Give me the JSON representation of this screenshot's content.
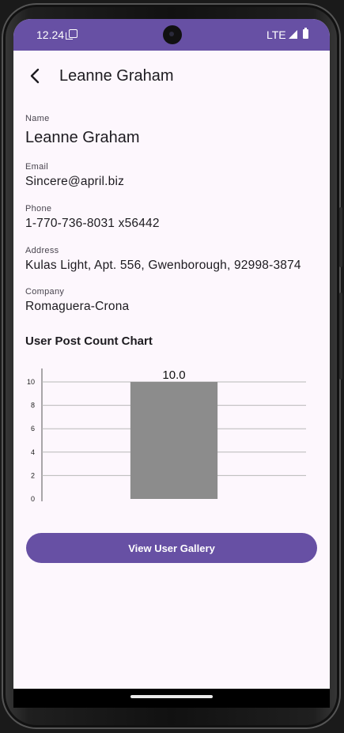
{
  "status_bar": {
    "time": "12.24",
    "network": "LTE"
  },
  "top_bar": {
    "title": "Leanne Graham"
  },
  "user": {
    "name_label": "Name",
    "name": "Leanne Graham",
    "email_label": "Email",
    "email": "Sincere@april.biz",
    "phone_label": "Phone",
    "phone": "1-770-736-8031 x56442",
    "address_label": "Address",
    "address": "Kulas Light, Apt. 556, Gwenborough, 92998-3874",
    "company_label": "Company",
    "company": "Romaguera-Crona"
  },
  "chart_section": {
    "title": "User Post Count Chart"
  },
  "chart_data": {
    "type": "bar",
    "categories": [
      ""
    ],
    "values": [
      10.0
    ],
    "value_labels": [
      "10.0"
    ],
    "ylim": [
      0,
      10
    ],
    "yticks": [
      "0",
      "2",
      "4",
      "6",
      "8",
      "10"
    ],
    "grid": true,
    "bar_color": "#8c8c8c"
  },
  "actions": {
    "gallery_button": "View User Gallery"
  },
  "colors": {
    "accent": "#6750a4",
    "background": "#fdf7fd"
  }
}
